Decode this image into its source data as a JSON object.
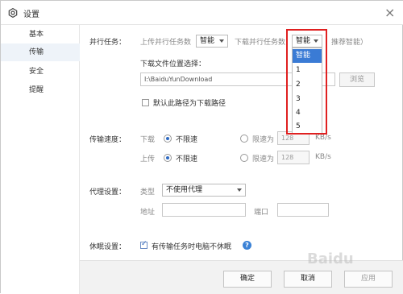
{
  "window": {
    "title": "设置",
    "close": "×"
  },
  "sidebar": {
    "items": [
      {
        "label": "基本"
      },
      {
        "label": "传输"
      },
      {
        "label": "安全"
      },
      {
        "label": "提醒"
      }
    ]
  },
  "parallel": {
    "section": "并行任务：",
    "upload_label": "上传并行任务数",
    "upload_value": "智能",
    "download_label": "下载并行任务数",
    "download_value": "智能",
    "hint": "推荐智能）",
    "options": [
      "智能",
      "1",
      "2",
      "3",
      "4",
      "5"
    ]
  },
  "download_path": {
    "label": "下载文件位置选择：",
    "value": "I:\\BaiduYunDownload",
    "browse": "浏览",
    "default_check": "默认此路径为下载路径"
  },
  "speed": {
    "section": "传输速度：",
    "download_label": "下载",
    "upload_label": "上传",
    "unlimited": "不限速",
    "limit": "限速为",
    "download_value": "128",
    "upload_value": "128",
    "unit": "KB/s"
  },
  "proxy": {
    "section": "代理设置：",
    "type_label": "类型",
    "type_value": "不使用代理",
    "address_label": "地址",
    "port_label": "端口"
  },
  "sleep": {
    "section": "休眠设置：",
    "check": "有传输任务时电脑不休眠",
    "help": "?"
  },
  "footer": {
    "ok": "确定",
    "cancel": "取消",
    "apply": "应用"
  },
  "watermark": "Baidu"
}
